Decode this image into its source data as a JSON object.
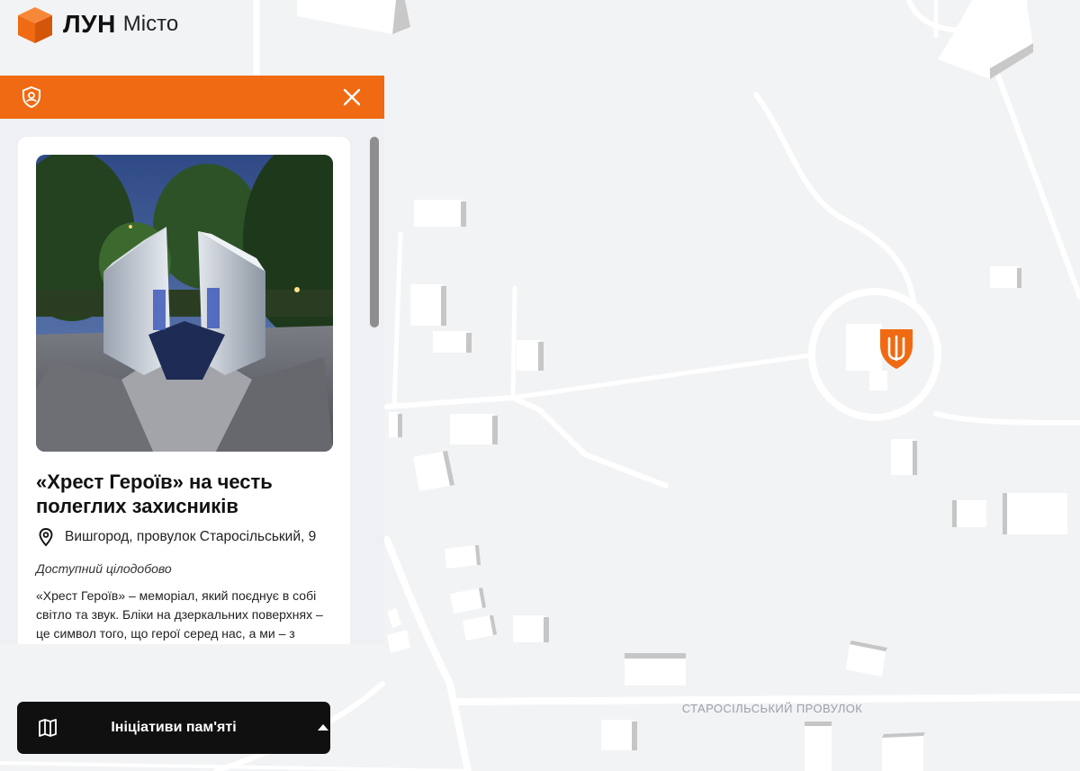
{
  "brand": {
    "name": "ЛУН",
    "product": "Місто",
    "accent": "#ef6a13"
  },
  "panel": {
    "header_icon": "shield-user-icon",
    "close_icon": "close-icon",
    "place": {
      "title": "«Хрест Героїв» на честь полеглих захисників",
      "address": "Вишгород, провулок Старосільський, 9",
      "hours": "Доступний цілодобово",
      "description": "«Хрест Героїв» – меморіал, який поєднує в собі світло та звук. Бліки на дзеркальних поверхнях – це символ того, що герої серед нас, а ми – з"
    }
  },
  "map": {
    "street_label": "СТАРОСІЛЬСЬКИЙ ПРОВУЛОК",
    "marker_icon": "trident-shield-icon"
  },
  "bottom_button": {
    "label": "Ініціативи пам'яті",
    "icon": "map-icon",
    "caret_icon": "caret-up-icon"
  }
}
